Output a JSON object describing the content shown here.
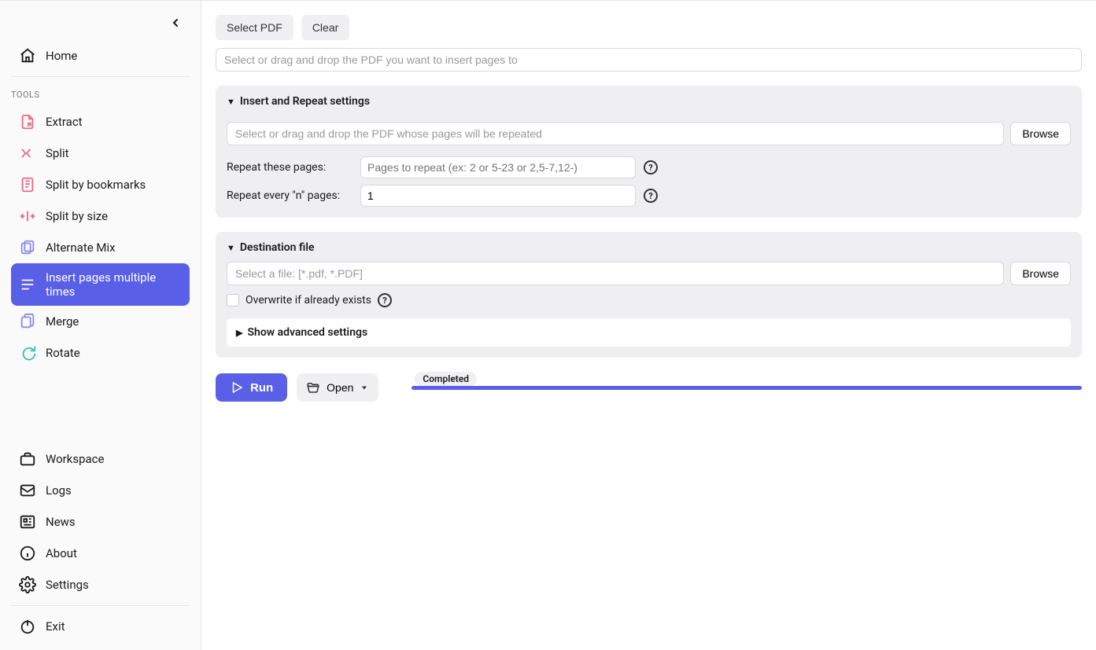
{
  "sidebar": {
    "home": "Home",
    "toolsLabel": "TOOLS",
    "tools": [
      {
        "label": "Extract"
      },
      {
        "label": "Split"
      },
      {
        "label": "Split by bookmarks"
      },
      {
        "label": "Split by size"
      },
      {
        "label": "Alternate Mix"
      },
      {
        "label": "Insert pages multiple times"
      },
      {
        "label": "Merge"
      },
      {
        "label": "Rotate"
      }
    ],
    "bottom": {
      "workspace": "Workspace",
      "logs": "Logs",
      "news": "News",
      "about": "About",
      "settings": "Settings",
      "exit": "Exit"
    }
  },
  "main": {
    "selectPdf": "Select PDF",
    "clear": "Clear",
    "targetPlaceholder": "Select or drag and drop the PDF you want to insert pages to",
    "insertPanel": {
      "title": "Insert and Repeat settings",
      "sourcePlaceholder": "Select or drag and drop the PDF whose pages will be repeated",
      "browse": "Browse",
      "repeatPagesLabel": "Repeat these pages:",
      "repeatPagesPlaceholder": "Pages to repeat (ex: 2 or 5-23 or 2,5-7,12-)",
      "repeatEveryLabel": "Repeat every \"n\" pages:",
      "repeatEveryValue": "1"
    },
    "destPanel": {
      "title": "Destination file",
      "placeholder": "Select a file: [*.pdf, *.PDF]",
      "browse": "Browse",
      "overwrite": "Overwrite if already exists",
      "advanced": "Show advanced settings"
    },
    "run": "Run",
    "open": "Open",
    "status": "Completed"
  }
}
